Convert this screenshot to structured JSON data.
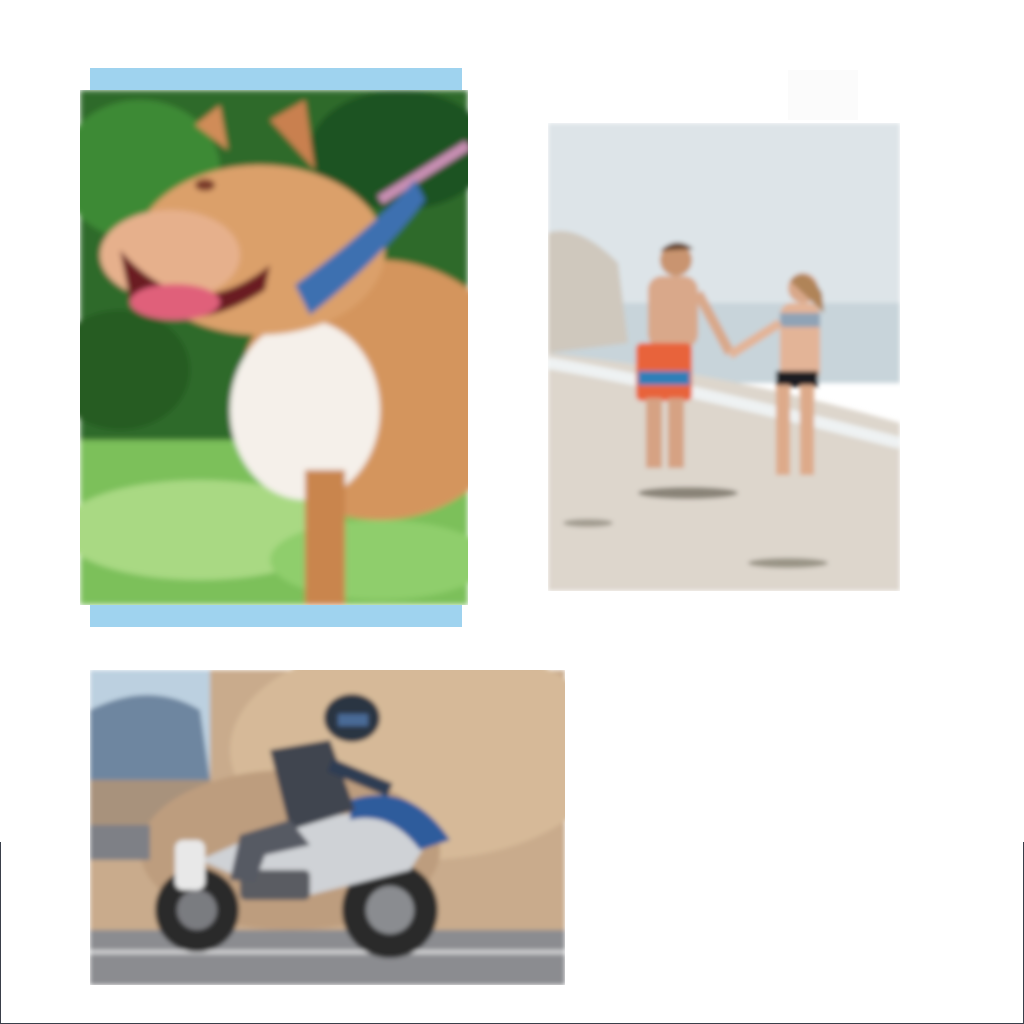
{
  "canvas": {
    "background": "#ffffff",
    "frame_color": "#3a3f4a"
  },
  "photos": [
    {
      "subject": "dog-photo",
      "accent": "#9fd3ef",
      "palette": {
        "grass": "#7cc05a",
        "foliage": "#2e6a2a",
        "fur": "#d4955d",
        "chest": "#f5f0ea",
        "collar": "#3e6fb0",
        "tongue": "#e0607a"
      }
    },
    {
      "subject": "beach-couple-photo",
      "palette": {
        "sky": "#dde4e8",
        "sea": "#c8d4da",
        "sand": "#ddd6cc",
        "rock": "#cfc8bd",
        "skin": "#d9a88a",
        "shorts": "#e8633a"
      }
    },
    {
      "subject": "motorcycle-photo",
      "palette": {
        "sky": "#bcd0e0",
        "mountain": "#6e86a0",
        "rock": "#c9ab8c",
        "road": "#8b8c90",
        "bike_blue": "#2f5c9c",
        "tire": "#2a2a2c"
      }
    }
  ]
}
